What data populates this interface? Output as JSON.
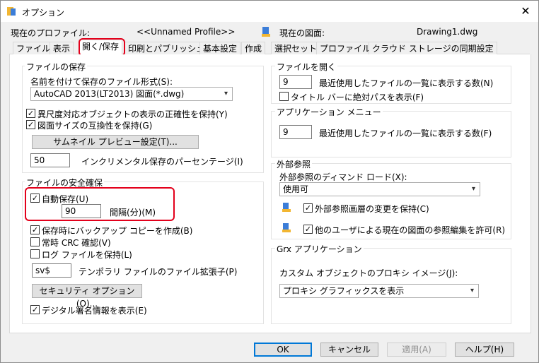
{
  "window": {
    "title": "オプション",
    "close_icon": "close-icon"
  },
  "header": {
    "profile_label": "現在のプロファイル:",
    "profile_value": "<<Unnamed Profile>>",
    "drawing_label": "現在の図面:",
    "drawing_value": "Drawing1.dwg"
  },
  "tabs": [
    "ファイル",
    "表示",
    "開く/保存",
    "印刷とパブリッシュ",
    "基本設定",
    "作成",
    "選択セット",
    "プロファイル",
    "クラウド ストレージの同期設定"
  ],
  "active_tab": "開く/保存",
  "file_save": {
    "title": "ファイルの保存",
    "format_label": "名前を付けて保存のファイル形式(S):",
    "format_value": "AutoCAD 2013(LT2013) 図面(*.dwg)",
    "annotative_label": "異尺度対応オブジェクトの表示の正確性を保持(Y)",
    "annotative_checked": true,
    "size_compat_label": "図面サイズの互換性を保持(G)",
    "size_compat_checked": true,
    "thumbnail_button": "サムネイル プレビュー設定(T)...",
    "incremental_value": "50",
    "incremental_label": "インクリメンタル保存のパーセンテージ(I)"
  },
  "file_safety": {
    "title": "ファイルの安全確保",
    "autosave_label": "自動保存(U)",
    "autosave_checked": true,
    "interval_value": "90",
    "interval_label": "間隔(分)(M)",
    "backup_label": "保存時にバックアップ コピーを作成(B)",
    "backup_checked": true,
    "crc_label": "常時 CRC 確認(V)",
    "crc_checked": false,
    "log_label": "ログ ファイルを保持(L)",
    "log_checked": false,
    "temp_ext_value": "sv$",
    "temp_ext_label": "テンポラリ ファイルのファイル拡張子(P)",
    "security_button": "セキュリティ オプション(O)...",
    "signature_label": "デジタル署名情報を表示(E)",
    "signature_checked": true
  },
  "file_open": {
    "title": "ファイルを開く",
    "recent_value": "9",
    "recent_label": "最近使用したファイルの一覧に表示する数(N)",
    "fullpath_label": "タイトル バーに絶対パスを表示(F)",
    "fullpath_checked": false
  },
  "app_menu": {
    "title": "アプリケーション メニュー",
    "recent_value": "9",
    "recent_label": "最近使用したファイルの一覧に表示する数(F)"
  },
  "xref": {
    "title": "外部参照",
    "demand_label": "外部参照のディマンド ロード(X):",
    "demand_value": "使用可",
    "layer_label": "外部参照画層の変更を保持(C)",
    "layer_checked": true,
    "edit_label": "他のユーザによる現在の図面の参照編集を許可(R)",
    "edit_checked": true
  },
  "objectarx": {
    "title": "Grx アプリケーション",
    "proxy_label": "カスタム オブジェクトのプロキシ イメージ(J):",
    "proxy_value": "プロキシ グラフィックスを表示"
  },
  "footer": {
    "ok": "OK",
    "cancel": "キャンセル",
    "apply": "適用(A)",
    "help": "ヘルプ(H)"
  },
  "colors": {
    "highlight": "#e3001b",
    "focus": "#0078d7"
  }
}
